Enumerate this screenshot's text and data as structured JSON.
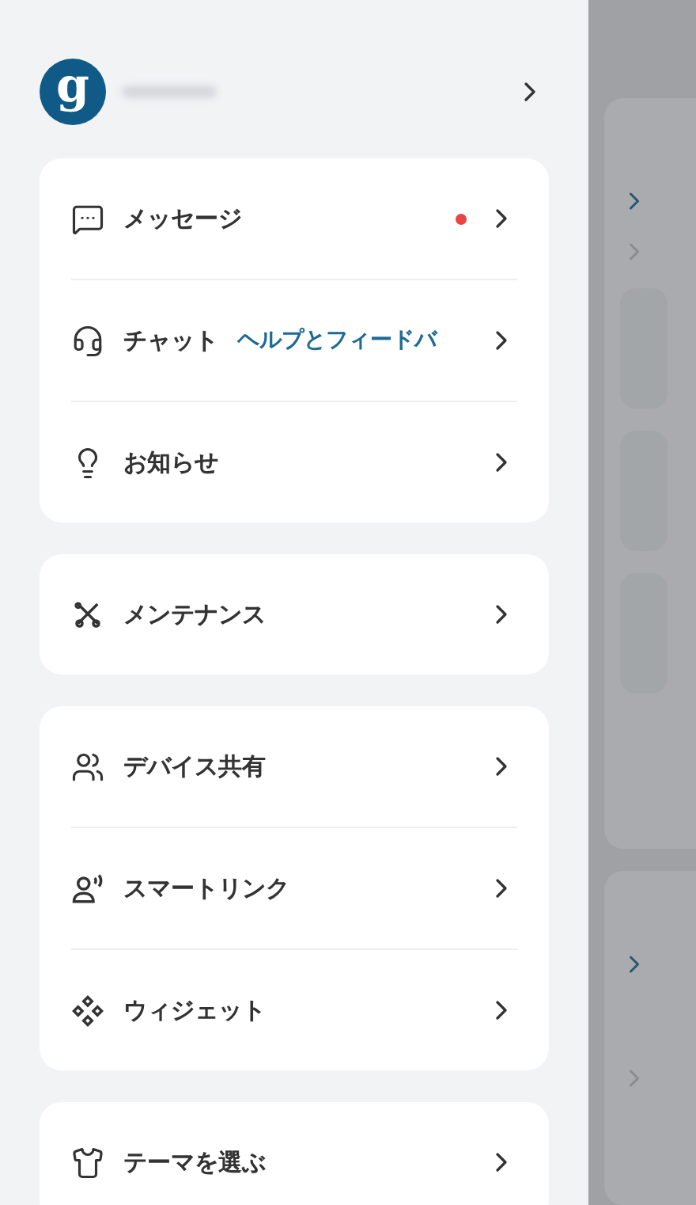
{
  "profile": {
    "avatar_letter": "g"
  },
  "groups": [
    {
      "items": [
        {
          "label": "メッセージ",
          "unread": true
        },
        {
          "label": "チャット",
          "subtitle": "ヘルプとフィードバ",
          "unread": false
        },
        {
          "label": "お知らせ",
          "unread": false
        }
      ]
    },
    {
      "items": [
        {
          "label": "メンテナンス",
          "unread": false
        }
      ]
    },
    {
      "items": [
        {
          "label": "デバイス共有",
          "unread": false
        },
        {
          "label": "スマートリンク",
          "unread": false
        },
        {
          "label": "ウィジェット",
          "unread": false
        }
      ]
    },
    {
      "items": [
        {
          "label": "テーマを選ぶ",
          "unread": false
        }
      ]
    }
  ]
}
